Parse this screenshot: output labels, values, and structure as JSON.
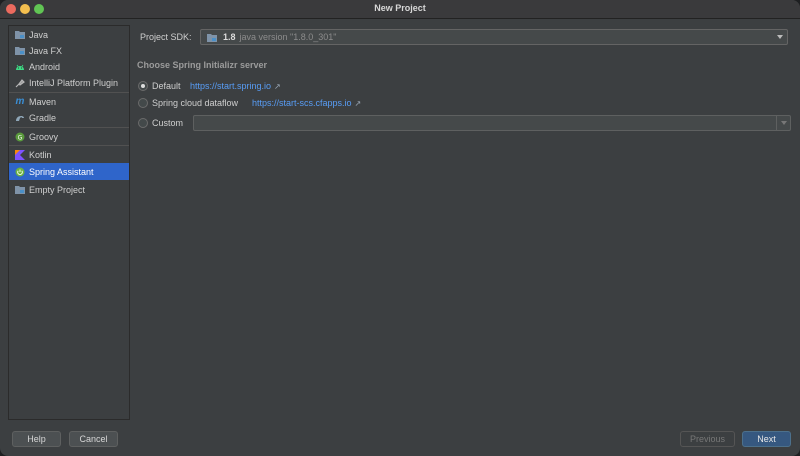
{
  "window": {
    "title": "New Project"
  },
  "sidebar": {
    "items": [
      {
        "label": "Java",
        "icon": "folder-icon"
      },
      {
        "label": "Java FX",
        "icon": "folder-icon"
      },
      {
        "label": "Android",
        "icon": "android-icon"
      },
      {
        "label": "IntelliJ Platform Plugin",
        "icon": "plugin-icon"
      },
      {
        "label": "Maven",
        "icon": "maven-icon"
      },
      {
        "label": "Gradle",
        "icon": "gradle-icon"
      },
      {
        "label": "Groovy",
        "icon": "groovy-icon"
      },
      {
        "label": "Kotlin",
        "icon": "kotlin-icon"
      },
      {
        "label": "Spring Assistant",
        "icon": "spring-icon",
        "selected": true
      },
      {
        "label": "Empty Project",
        "icon": "folder-icon"
      }
    ]
  },
  "main": {
    "sdk_label": "Project SDK:",
    "sdk_version": "1.8",
    "sdk_description": "java version \"1.8.0_301\"",
    "section_title": "Choose Spring Initializr server",
    "options": [
      {
        "label": "Default",
        "url": "https://start.spring.io",
        "checked": true
      },
      {
        "label": "Spring cloud dataflow",
        "url": "https://start-scs.cfapps.io",
        "checked": false
      },
      {
        "label": "Custom",
        "value": "",
        "checked": false
      }
    ],
    "external_link_glyph": "↗"
  },
  "footer": {
    "help": "Help",
    "cancel": "Cancel",
    "previous": "Previous",
    "next": "Next"
  },
  "colors": {
    "background": "#3c3f41",
    "selection": "#2f65ca",
    "link": "#589df6",
    "primary_button": "#365880",
    "spring_green": "#6db33f",
    "kotlin_purple": "#7f52ff"
  }
}
